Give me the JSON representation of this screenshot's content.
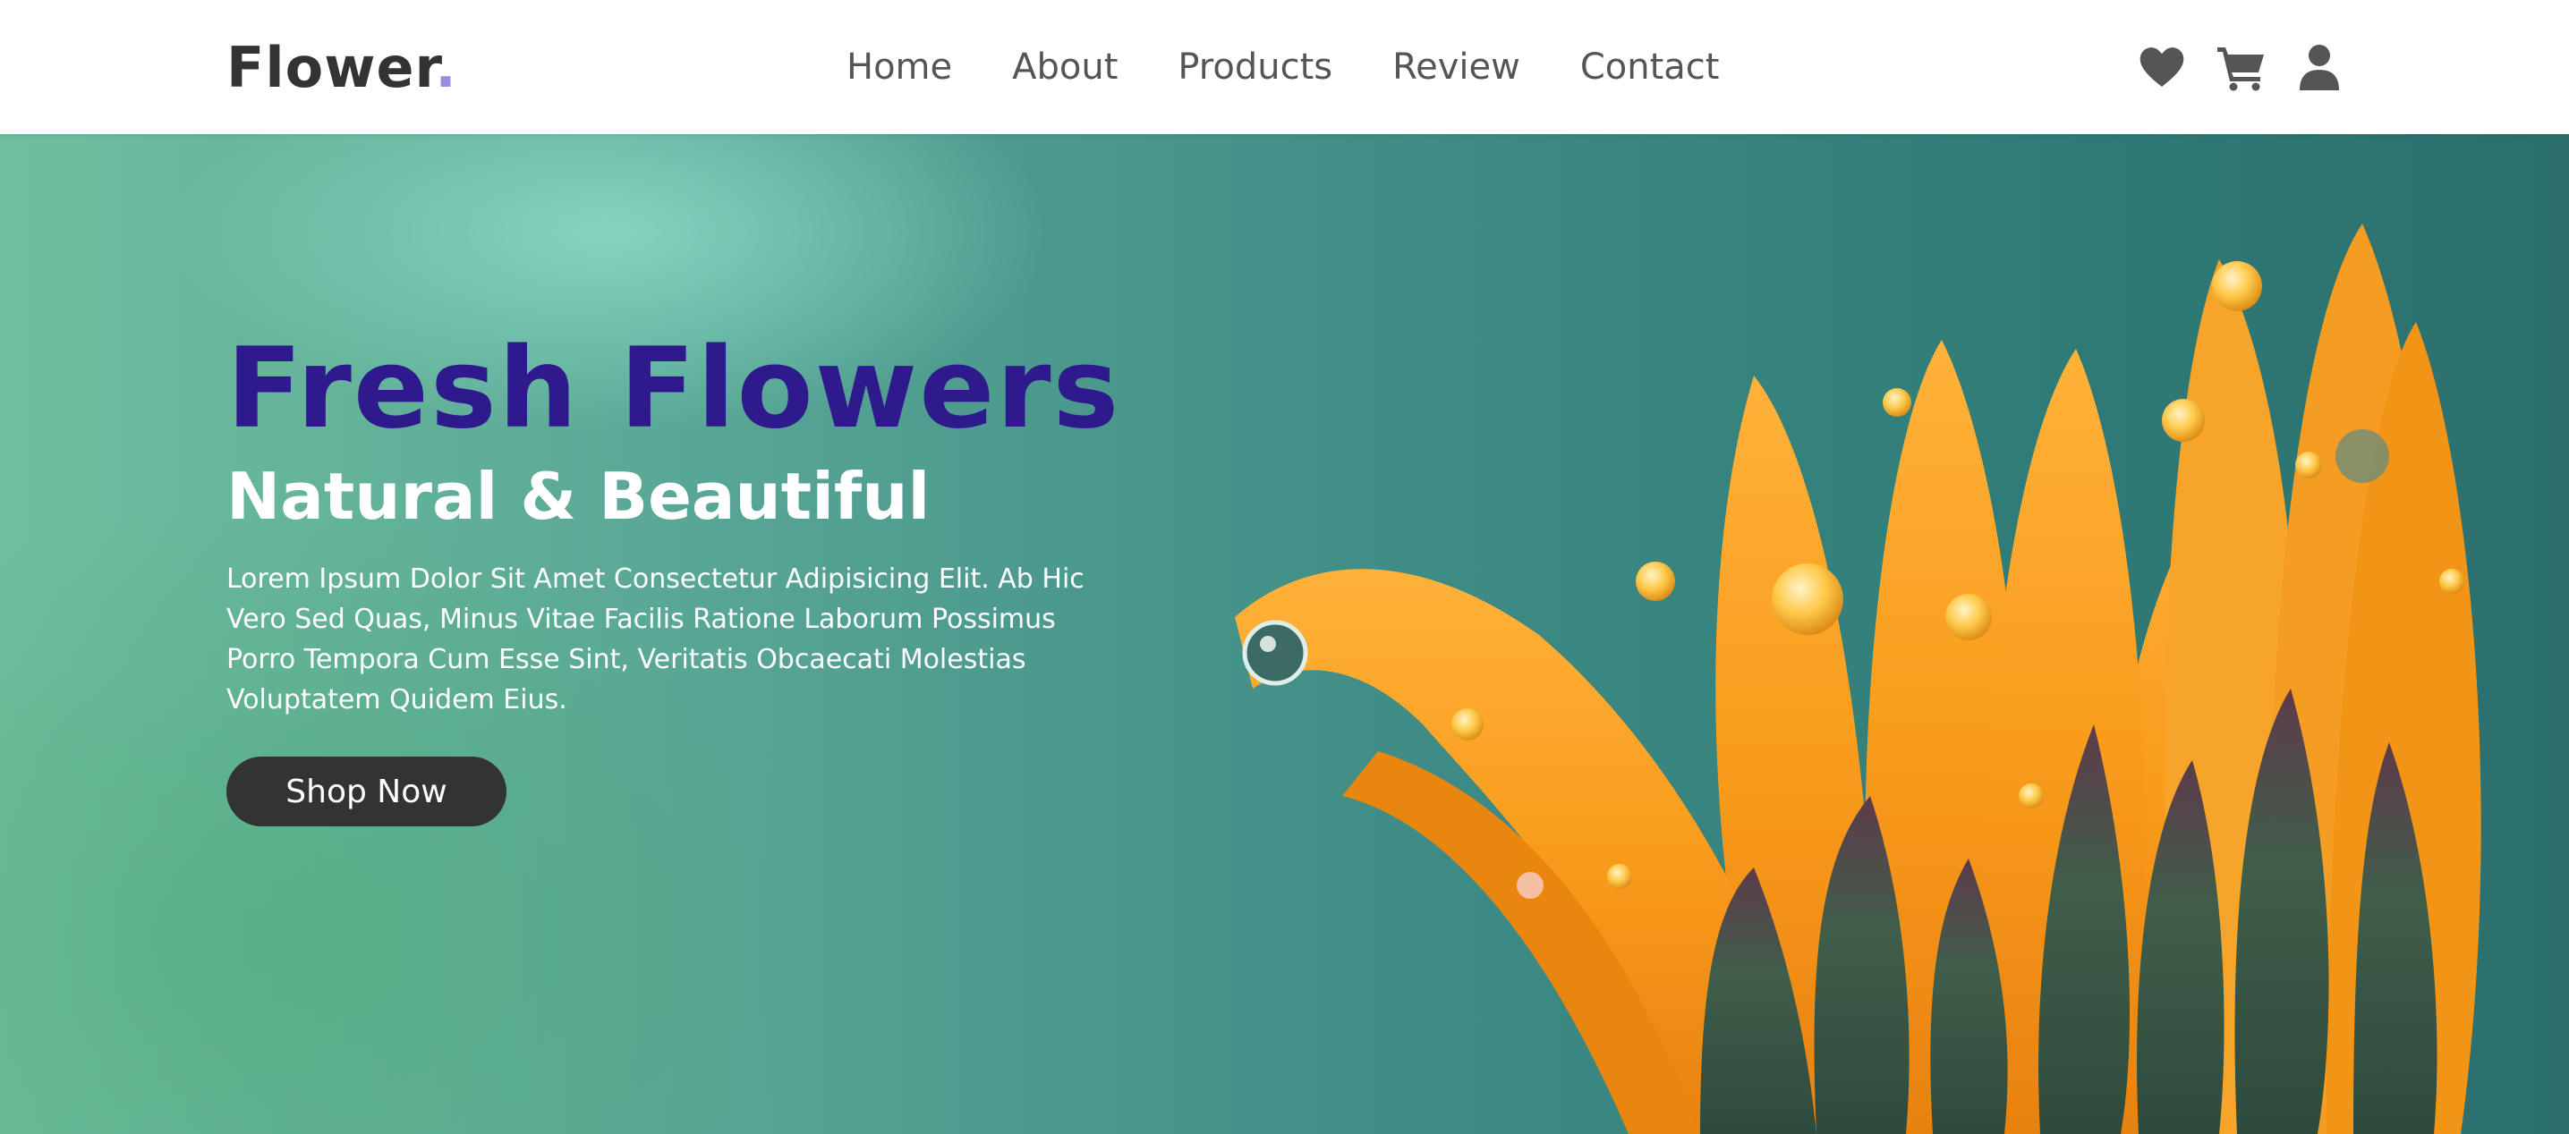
{
  "header": {
    "logo_text": "Flower",
    "logo_dot": ".",
    "nav": [
      {
        "label": "Home"
      },
      {
        "label": "About"
      },
      {
        "label": "Products"
      },
      {
        "label": "Review"
      },
      {
        "label": "Contact"
      }
    ],
    "icons": [
      "heart-icon",
      "cart-icon",
      "user-icon"
    ]
  },
  "hero": {
    "title": "Fresh Flowers",
    "subtitle": "Natural & Beautiful",
    "description": "Lorem Ipsum Dolor Sit Amet Consectetur Adipisicing Elit. Ab Hic Vero Sed Quas, Minus Vitae Facilis Ratione Laborum Possimus Porro Tempora Cum Esse Sint, Veritatis Obcaecati Molestias Voluptatem Quidem Eius.",
    "button_label": "Shop Now"
  },
  "colors": {
    "title": "#2e1a8c",
    "logo_dot": "#9b8de0",
    "button_bg": "#333333",
    "nav_text": "#555555"
  }
}
